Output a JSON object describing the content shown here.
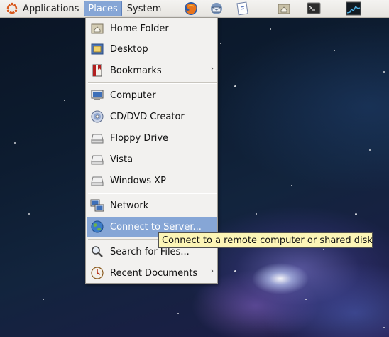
{
  "panel": {
    "applications_label": "Applications",
    "places_label": "Places",
    "system_label": "System",
    "launchers": [
      "firefox-icon",
      "mail-client-icon",
      "notes-icon",
      "home-folder-icon",
      "terminal-icon",
      "system-monitor-icon"
    ]
  },
  "places_menu": {
    "items": [
      {
        "label": "Home Folder",
        "icon": "home-folder-icon"
      },
      {
        "label": "Desktop",
        "icon": "desktop-icon"
      },
      {
        "label": "Bookmarks",
        "icon": "bookmarks-icon",
        "submenu": true
      },
      {
        "label": "Computer",
        "icon": "computer-icon"
      },
      {
        "label": "CD/DVD Creator",
        "icon": "cd-dvd-icon"
      },
      {
        "label": "Floppy Drive",
        "icon": "drive-icon"
      },
      {
        "label": "Vista",
        "icon": "drive-icon"
      },
      {
        "label": "Windows XP",
        "icon": "drive-icon"
      },
      {
        "label": "Network",
        "icon": "network-icon"
      },
      {
        "label": "Connect to Server...",
        "icon": "globe-icon",
        "highlighted": true
      },
      {
        "label": "Search for Files...",
        "icon": "search-icon"
      },
      {
        "label": "Recent Documents",
        "icon": "recent-documents-icon",
        "submenu": true
      }
    ],
    "submenu_arrow": "›"
  },
  "tooltip": {
    "text": "Connect to a remote computer or shared disk"
  },
  "colors": {
    "highlight": "#86a6d6",
    "tooltip_bg": "#fcf5b6",
    "menu_bg": "#f2f1ef"
  }
}
